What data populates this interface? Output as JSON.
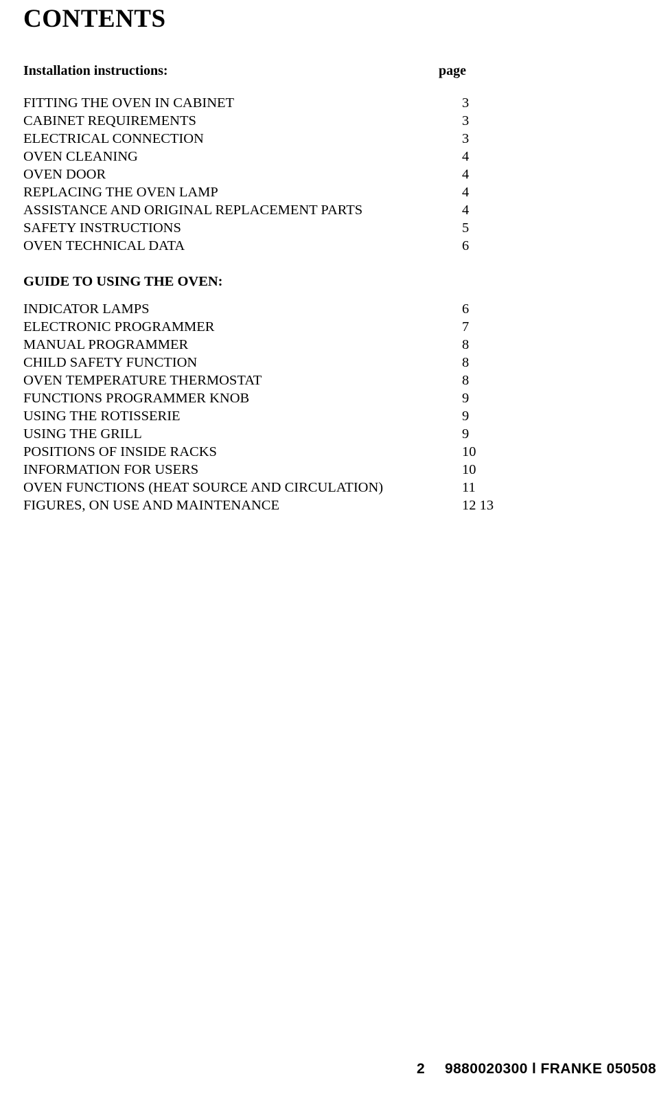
{
  "document": {
    "title": "CONTENTS",
    "page_column_label": "page",
    "sections": [
      {
        "heading": "Installation instructions:",
        "entries": [
          {
            "title": "FITTING THE OVEN IN CABINET",
            "page": "3"
          },
          {
            "title": "CABINET REQUIREMENTS",
            "page": "3"
          },
          {
            "title": "ELECTRICAL CONNECTION",
            "page": "3"
          },
          {
            "title": "OVEN CLEANING",
            "page": "4"
          },
          {
            "title": "OVEN DOOR",
            "page": "4"
          },
          {
            "title": "REPLACING THE OVEN LAMP",
            "page": "4"
          },
          {
            "title": "ASSISTANCE AND ORIGINAL REPLACEMENT PARTS",
            "page": "4"
          },
          {
            "title": "SAFETY INSTRUCTIONS",
            "page": "5"
          },
          {
            "title": "OVEN TECHNICAL DATA",
            "page": "6"
          }
        ]
      },
      {
        "heading": "GUIDE TO USING THE OVEN:",
        "entries": [
          {
            "title": "INDICATOR LAMPS",
            "page": "6"
          },
          {
            "title": "ELECTRONIC PROGRAMMER",
            "page": "7"
          },
          {
            "title": "MANUAL PROGRAMMER",
            "page": "8"
          },
          {
            "title": "CHILD SAFETY FUNCTION",
            "page": "8"
          },
          {
            "title": "OVEN TEMPERATURE THERMOSTAT",
            "page": "8"
          },
          {
            "title": "FUNCTIONS PROGRAMMER KNOB",
            "page": "9"
          },
          {
            "title": "USING THE ROTISSERIE",
            "page": "9"
          },
          {
            "title": "USING THE GRILL",
            "page": "9"
          },
          {
            "title": "POSITIONS OF INSIDE RACKS",
            "page": "10"
          },
          {
            "title": "INFORMATION FOR USERS",
            "page": "10"
          },
          {
            "title": "OVEN FUNCTIONS (HEAT SOURCE AND CIRCULATION)",
            "page": "11"
          },
          {
            "title": "FIGURES, ON USE AND MAINTENANCE",
            "page": "12  13"
          }
        ]
      }
    ],
    "footer": {
      "page_number": "2",
      "document_id": "9880020300 l FRANKE 050508"
    }
  }
}
